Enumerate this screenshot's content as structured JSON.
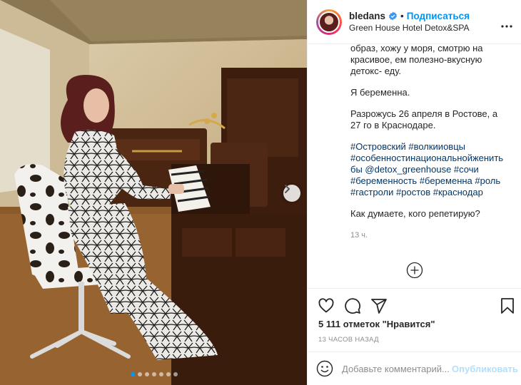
{
  "post": {
    "username": "bledans",
    "separator": "•",
    "follow_label": "Подписаться",
    "location": "Green House Hotel Detox&SPA",
    "caption_lines": [
      "образ, хожу у моря, смотрю на",
      "красивое, ем полезно-вкусную",
      "детокс- еду."
    ],
    "pregnant_line": "Я беременна.",
    "tour_lines": [
      "Разрожусь 26 апреля в Ростове, а",
      "27 го в Краснодаре."
    ],
    "hashtag_lines": [
      "#Островский #волкииовцы",
      "#особенностинациональнойженить",
      "бы @detox_greenhouse #сочи",
      "#беременность #беременна #роль",
      "#гастроли #ростов #краснодар"
    ],
    "question": "Как думаете, кого репетирую?",
    "caption_time": "13 ч.",
    "likes": "5 111 отметок \"Нравится\"",
    "time_ago": "13 ЧАСОВ НАЗАД",
    "comment_placeholder": "Добавьте комментарий...",
    "publish_label": "Опубликовать"
  },
  "icons": {
    "verified": "verified-badge-icon",
    "more": "more-options-icon",
    "load_more": "plus-circle-icon",
    "like": "heart-icon",
    "comment": "comment-icon",
    "share": "paper-plane-icon",
    "save": "bookmark-icon",
    "emoji": "smiley-icon",
    "next": "chevron-right-icon"
  },
  "carousel": {
    "total": 7,
    "active": 1
  },
  "colors": {
    "accent": "#0095f6",
    "hashtag": "#00376b",
    "muted": "#8e8e8e",
    "publish_disabled": "#b2dffc"
  }
}
